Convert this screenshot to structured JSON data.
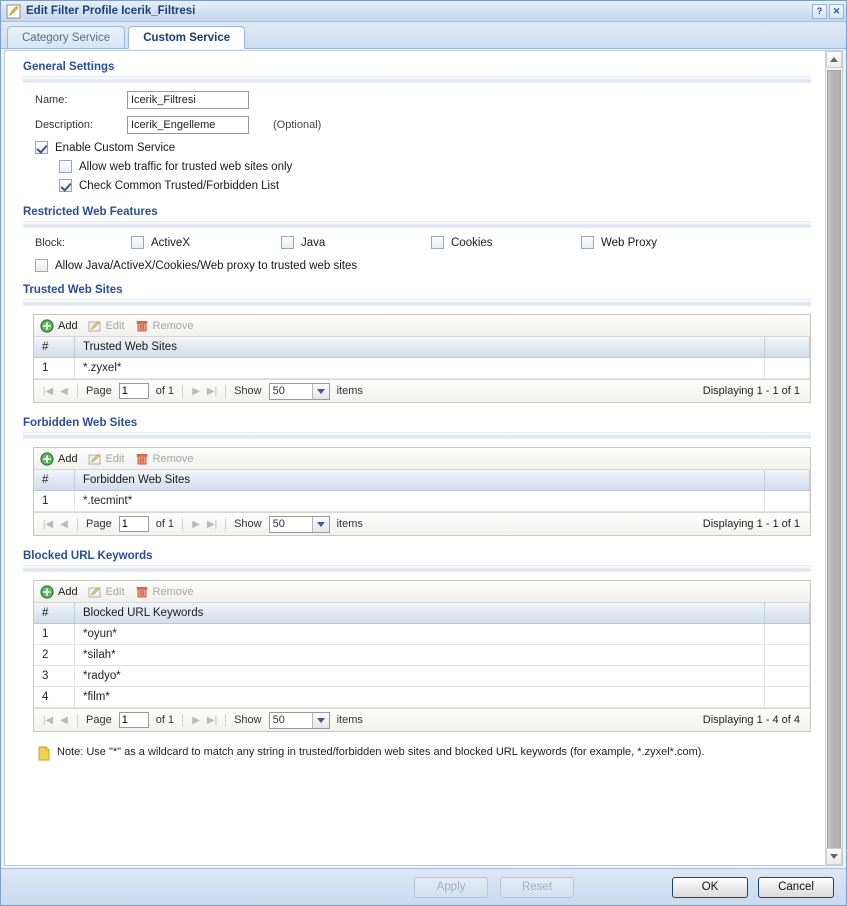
{
  "window": {
    "title": "Edit Filter Profile Icerik_Filtresi",
    "icon": "edit-pencil-icon",
    "help_button": "?",
    "close_button": "✕"
  },
  "tabs": [
    {
      "label": "Category Service",
      "active": false
    },
    {
      "label": "Custom Service",
      "active": true
    }
  ],
  "general_settings": {
    "title": "General Settings",
    "name_label": "Name:",
    "name_value": "Icerik_Filtresi",
    "description_label": "Description:",
    "description_value": "Icerik_Engelleme",
    "optional_note": "(Optional)",
    "enable_custom_service": {
      "label": "Enable Custom Service",
      "checked": true
    },
    "allow_trusted_only": {
      "label": "Allow web traffic for trusted web sites only",
      "checked": false
    },
    "check_common_list": {
      "label": "Check Common Trusted/Forbidden List",
      "checked": true
    }
  },
  "restricted_web_features": {
    "title": "Restricted Web Features",
    "block_label": "Block:",
    "items": [
      {
        "label": "ActiveX",
        "checked": false
      },
      {
        "label": "Java",
        "checked": false
      },
      {
        "label": "Cookies",
        "checked": false
      },
      {
        "label": "Web Proxy",
        "checked": false
      }
    ],
    "allow_trusted": {
      "label": "Allow Java/ActiveX/Cookies/Web proxy to trusted web sites",
      "checked": false
    }
  },
  "toolbar": {
    "add_label": "Add",
    "edit_label": "Edit",
    "remove_label": "Remove",
    "add_icon": "add-circle-icon",
    "edit_icon": "edit-pencil-icon",
    "remove_icon": "trash-icon"
  },
  "pager": {
    "page_label": "Page",
    "page_value": "1",
    "of_label": "of 1",
    "show_label": "Show",
    "show_value": "50",
    "items_label": "items",
    "first_icon": "first-page-icon",
    "prev_icon": "prev-page-icon",
    "next_icon": "next-page-icon",
    "last_icon": "last-page-icon"
  },
  "trusted_web_sites": {
    "title": "Trusted Web Sites",
    "columns": [
      "#",
      "Trusted Web Sites"
    ],
    "rows": [
      {
        "num": "1",
        "value": "*.zyxel*"
      }
    ],
    "displaying": "Displaying 1 - 1 of 1"
  },
  "forbidden_web_sites": {
    "title": "Forbidden Web Sites",
    "columns": [
      "#",
      "Forbidden Web Sites"
    ],
    "rows": [
      {
        "num": "1",
        "value": "*.tecmint*"
      }
    ],
    "displaying": "Displaying 1 - 1 of 1"
  },
  "blocked_url_keywords": {
    "title": "Blocked URL Keywords",
    "columns": [
      "#",
      "Blocked URL Keywords"
    ],
    "rows": [
      {
        "num": "1",
        "value": "*oyun*"
      },
      {
        "num": "2",
        "value": "*silah*"
      },
      {
        "num": "3",
        "value": "*radyo*"
      },
      {
        "num": "4",
        "value": "*film*"
      }
    ],
    "displaying": "Displaying 1 - 4 of 4"
  },
  "note": {
    "icon": "note-icon",
    "text": "Note: Use \"*\" as a wildcard to match any string in trusted/forbidden web sites and blocked URL keywords (for example, *.zyxel*.com)."
  },
  "footer": {
    "apply_label": "Apply",
    "reset_label": "Reset",
    "ok_label": "OK",
    "cancel_label": "Cancel"
  },
  "colors": {
    "accent_blue": "#2a4f94",
    "title_blue": "#1f3f77",
    "add_green": "#3f9b42",
    "remove_red": "#c4502f"
  }
}
